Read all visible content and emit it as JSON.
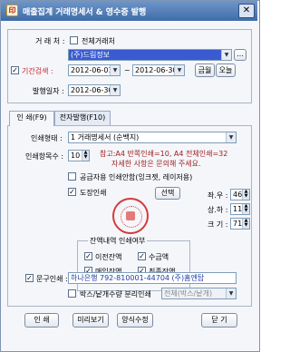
{
  "window": {
    "title": "매출집계 거래명세서 & 영수증 발행",
    "close": "✕",
    "app_glyph": "印"
  },
  "customer": {
    "label": "거 래 처 :",
    "all_label": "전체거래처",
    "all_checked": false,
    "value": "(주)드림정보"
  },
  "period": {
    "label": "기간검색 :",
    "checked": true,
    "start": "2012-06-01",
    "tilde": "~",
    "end": "2012-06-30",
    "this_month_button": "금월",
    "today_button": "오늘"
  },
  "issue_date": {
    "label": "발행일자 :",
    "value": "2012-06-30"
  },
  "tabs": [
    {
      "label": "인 쇄(F9)",
      "active": true
    },
    {
      "label": "전자발행(F10)",
      "active": false
    }
  ],
  "print_form": {
    "label": "인쇄형태 :",
    "value": "1 거래명세서 (순백지)"
  },
  "copies": {
    "label": "인쇄항목수 :",
    "value": "10",
    "note_line1": "참고:A4 반쪽인쇄=10, A4 전체인쇄=32",
    "note_line2": "자세한 사항은 문의해 주세요."
  },
  "supplier_option": {
    "label": "공급자용 인쇄안함(잉크젯, 레이저용)",
    "checked": false
  },
  "stamp": {
    "label": "도장인쇄",
    "checked": true,
    "select_button": "선택",
    "lr_label": "좌.우 :",
    "lr_value": "461",
    "ud_label": "상.하 :",
    "ud_value": "111",
    "size_label": "크 기 :",
    "size_value": "71"
  },
  "balance": {
    "legend": "잔액내역 인쇄여부",
    "items": [
      {
        "label": "이전잔액",
        "checked": true
      },
      {
        "label": "수금액",
        "checked": true
      },
      {
        "label": "매입잔액",
        "checked": true
      },
      {
        "label": "최종잔액",
        "checked": true
      }
    ]
  },
  "phrase": {
    "label": "문구인쇄 :",
    "checked": true,
    "value": "하나은행 792-810001-44704 (주)홈엔탑"
  },
  "box_option": {
    "label": "박스/낱개수량 분리인쇄",
    "checked": false,
    "value": "전체(박스/낱개)"
  },
  "buttons": {
    "print": "인 쇄",
    "preview": "미리보기",
    "form_edit": "양식수정",
    "close": "닫 기"
  },
  "colors": {
    "accent_red": "#c62828",
    "phrase_text": "#1f3aa5",
    "note_text": "#a02020"
  }
}
